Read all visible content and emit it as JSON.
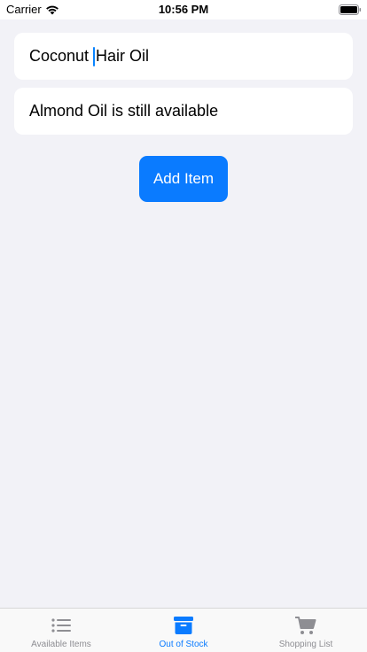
{
  "status_bar": {
    "carrier": "Carrier",
    "time": "10:56 PM"
  },
  "form": {
    "item_name_value_before_caret": "Coconut",
    "item_name_value_after_caret": "Hair Oil",
    "status_text": "Almond Oil is still available",
    "add_button_label": "Add Item"
  },
  "tab_bar": {
    "tabs": [
      {
        "label": "Available Items",
        "icon": "list-icon",
        "active": false
      },
      {
        "label": "Out of Stock",
        "icon": "archive-box-icon",
        "active": true
      },
      {
        "label": "Shopping List",
        "icon": "cart-icon",
        "active": false
      }
    ]
  },
  "colors": {
    "accent": "#0a7bff",
    "inactive_tab": "#8e8e93",
    "background": "#f2f2f7"
  }
}
